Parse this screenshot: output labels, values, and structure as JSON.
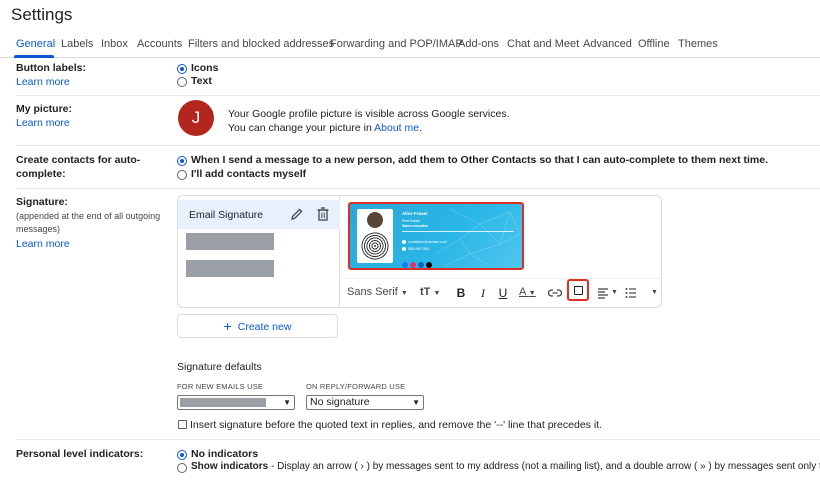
{
  "header": {
    "title": "Settings"
  },
  "tabs": [
    {
      "label": "General",
      "active": true
    },
    {
      "label": "Labels"
    },
    {
      "label": "Inbox"
    },
    {
      "label": "Accounts"
    },
    {
      "label": "Filters and blocked addresses"
    },
    {
      "label": "Forwarding and POP/IMAP"
    },
    {
      "label": "Add-ons"
    },
    {
      "label": "Chat and Meet"
    },
    {
      "label": "Advanced"
    },
    {
      "label": "Offline"
    },
    {
      "label": "Themes"
    }
  ],
  "button_labels": {
    "label": "Button labels:",
    "learn_more": "Learn more",
    "options": [
      {
        "label": "Icons",
        "selected": true
      },
      {
        "label": "Text",
        "selected": false
      }
    ]
  },
  "my_picture": {
    "label": "My picture:",
    "learn_more": "Learn more",
    "avatar_letter": "J",
    "line1": "Your Google profile picture is visible across Google services.",
    "line2_prefix": "You can change your picture in ",
    "line2_link": "About me",
    "line2_suffix": "."
  },
  "create_contacts": {
    "label_line1": "Create contacts for auto-",
    "label_line2": "complete:",
    "options": [
      {
        "label": "When I send a message to a new person, add them to Other Contacts so that I can auto-complete to them next time.",
        "selected": true
      },
      {
        "label": "I'll add contacts myself",
        "selected": false
      }
    ]
  },
  "signature": {
    "label": "Signature:",
    "note_line1": "(appended at the end of all outgoing",
    "note_line2": "messages)",
    "learn_more": "Learn more",
    "list_active": "Email Signature",
    "card": {
      "name": "Alice Fraser",
      "role1": "Real Estate",
      "role2": "Sales executive",
      "email": "contactme@domain.com",
      "phone": "555 498 7890"
    },
    "toolbar": {
      "font": "Sans Serif",
      "size_icon": "tT",
      "bold": "B",
      "italic": "I",
      "underline": "U",
      "text_color": "A"
    },
    "create_new": "Create new",
    "defaults_title": "Signature defaults",
    "new_emails_label": "FOR NEW EMAILS USE",
    "reply_label": "ON REPLY/FORWARD USE",
    "reply_value": "No signature",
    "insert_before": "Insert signature before the quoted text in replies, and remove the '--' line that precedes it."
  },
  "personal_level": {
    "label": "Personal level indicators:",
    "opt1": "No indicators",
    "opt2_bold": "Show indicators",
    "opt2_rest": " - Display an arrow ( › ) by messages sent to my address (not a mailing list), and a double arrow ( » ) by messages sent only to me."
  },
  "colors": {
    "accent": "#0b57d0",
    "highlight_red": "#d93025",
    "avatar_bg": "#b3261e",
    "signature_bg": "#2aa8d8"
  }
}
